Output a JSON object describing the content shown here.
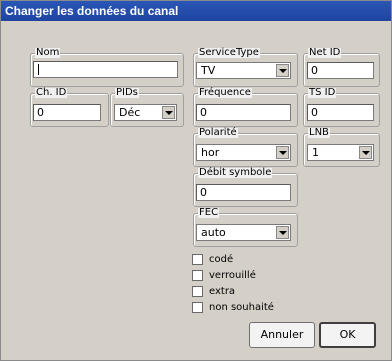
{
  "window": {
    "title": "Changer les données du canal"
  },
  "fields": {
    "nom": {
      "label": "Nom",
      "value": ""
    },
    "service_type": {
      "label": "ServiceType",
      "selected": "TV"
    },
    "net_id": {
      "label": "Net ID",
      "value": "0"
    },
    "ch_id": {
      "label": "Ch. ID",
      "value": "0"
    },
    "pids": {
      "label": "PIDs",
      "selected": "Déc"
    },
    "frequence": {
      "label": "Fréquence",
      "value": "0"
    },
    "ts_id": {
      "label": "TS ID",
      "value": "0"
    },
    "polarite": {
      "label": "Polarité",
      "selected": "hor"
    },
    "lnb": {
      "label": "LNB",
      "selected": "1"
    },
    "debit_symbole": {
      "label": "Débit symbole",
      "value": "0"
    },
    "fec": {
      "label": "FEC",
      "selected": "auto"
    }
  },
  "checkboxes": [
    {
      "label": "codé",
      "checked": false
    },
    {
      "label": "verrouillé",
      "checked": false
    },
    {
      "label": "extra",
      "checked": false
    },
    {
      "label": "non souhaité",
      "checked": false
    }
  ],
  "buttons": {
    "cancel": "Annuler",
    "ok": "OK"
  }
}
